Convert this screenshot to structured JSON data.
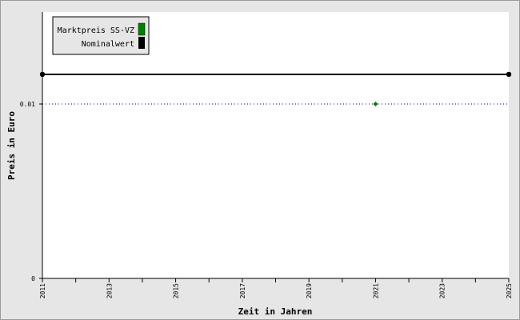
{
  "chart_data": {
    "type": "line",
    "title": "",
    "xlabel": "Zeit in Jahren",
    "ylabel": "Preis in Euro",
    "xlim": [
      2011,
      2025
    ],
    "ylim": [
      0,
      0.01
    ],
    "x_tick_labels": [
      "2011",
      "2013",
      "2015",
      "2017",
      "2019",
      "2021",
      "2023",
      "2025"
    ],
    "x_minor_ticks": [
      2012,
      2014,
      2016,
      2018,
      2020,
      2022,
      2024
    ],
    "y_tick_labels": [
      "0",
      "0.01"
    ],
    "y_ticks": [
      0,
      0.01
    ],
    "grid": "dotted horizontal at y ticks",
    "legend_position": "top-left",
    "series": [
      {
        "name": "Marktpreis SS-VZ",
        "color": "#008000",
        "points": [
          {
            "x": 2021,
            "y": 0.01
          }
        ]
      },
      {
        "name": "Nominalwert",
        "color": "#000000",
        "points": [
          {
            "x": 2011,
            "y": 0.0117
          },
          {
            "x": 2025,
            "y": 0.0117
          }
        ]
      }
    ]
  }
}
